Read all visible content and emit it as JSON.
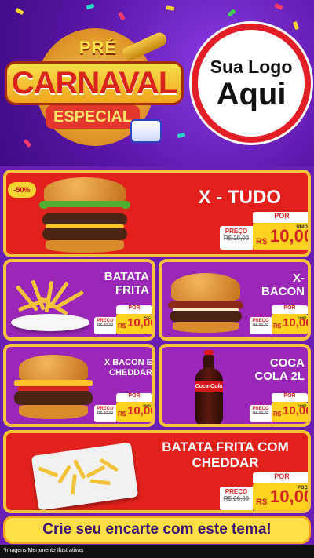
{
  "hero": {
    "title_pre": "PRÉ",
    "title_main": "CARNAVAL",
    "title_sub": "ESPECIAL",
    "logo_line1": "Sua Logo",
    "logo_line2": "Aqui"
  },
  "discount_badge": "-50%",
  "products": [
    {
      "name": "X - TUDO",
      "old_label": "PREÇO",
      "old_price": "R$ 20,00",
      "por_label": "POR",
      "currency": "R$",
      "price": "10,00",
      "unit": "UNID"
    },
    {
      "name_line1": "BATATA",
      "name_line2": "FRITA",
      "old_label": "PREÇO",
      "old_price": "R$ 20,00",
      "por_label": "POR",
      "currency": "R$",
      "price": "10,00",
      "unit": "POÇ"
    },
    {
      "name_line1": "X-",
      "name_line2": "BACON",
      "old_label": "PREÇO",
      "old_price": "R$ 20,00",
      "por_label": "POR",
      "currency": "R$",
      "price": "10,00",
      "unit": "UNID"
    },
    {
      "name_line1": "X BACON E",
      "name_line2": "CHEDDAR",
      "old_label": "PREÇO",
      "old_price": "R$ 20,00",
      "por_label": "POR",
      "currency": "R$",
      "price": "10,00",
      "unit": "UNID"
    },
    {
      "name_line1": "COCA",
      "name_line2": "COLA 2L",
      "old_label": "PREÇO",
      "old_price": "R$ 20,00",
      "por_label": "POR",
      "currency": "R$",
      "price": "10,00",
      "unit": "UNID"
    },
    {
      "name_line1": "BATATA FRITA COM",
      "name_line2": "CHEDDAR",
      "old_label": "PREÇO",
      "old_price": "R$ 20,00",
      "por_label": "POR",
      "currency": "R$",
      "price": "10,00",
      "unit": "POÇ"
    }
  ],
  "cta": "Crie seu encarte com este tema!",
  "disclaimer": "*Imagens Meramente Ilustrativas",
  "colors": {
    "red": "#e2211c",
    "purple": "#9b27b8",
    "yellow": "#ffd21f",
    "gold_border": "#f5c43a"
  }
}
